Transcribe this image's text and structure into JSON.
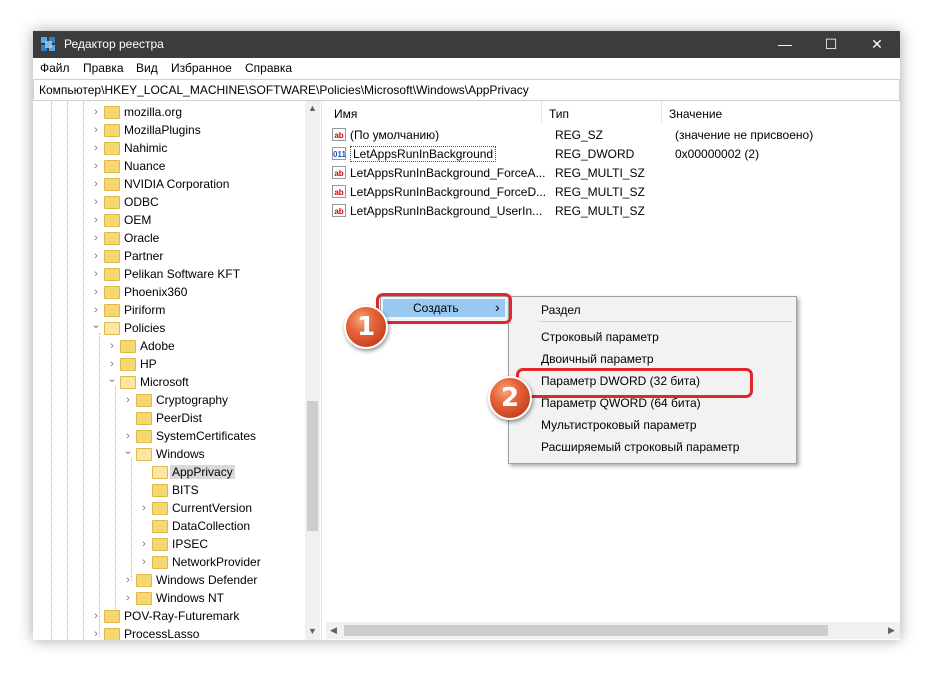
{
  "window": {
    "title": "Редактор реестра",
    "app_icon": "regedit-icon",
    "controls": {
      "minimize": "—",
      "maximize": "☐",
      "close": "✕"
    }
  },
  "menu": [
    "Файл",
    "Правка",
    "Вид",
    "Избранное",
    "Справка"
  ],
  "address": "Компьютер\\HKEY_LOCAL_MACHINE\\SOFTWARE\\Policies\\Microsoft\\Windows\\AppPrivacy",
  "tree": [
    {
      "label": "mozilla.org",
      "level": 0,
      "expander": "collapsed"
    },
    {
      "label": "MozillaPlugins",
      "level": 0,
      "expander": "collapsed"
    },
    {
      "label": "Nahimic",
      "level": 0,
      "expander": "collapsed"
    },
    {
      "label": "Nuance",
      "level": 0,
      "expander": "collapsed"
    },
    {
      "label": "NVIDIA Corporation",
      "level": 0,
      "expander": "collapsed"
    },
    {
      "label": "ODBC",
      "level": 0,
      "expander": "collapsed"
    },
    {
      "label": "OEM",
      "level": 0,
      "expander": "collapsed"
    },
    {
      "label": "Oracle",
      "level": 0,
      "expander": "collapsed"
    },
    {
      "label": "Partner",
      "level": 0,
      "expander": "collapsed"
    },
    {
      "label": "Pelikan Software KFT",
      "level": 0,
      "expander": "collapsed"
    },
    {
      "label": "Phoenix360",
      "level": 0,
      "expander": "collapsed"
    },
    {
      "label": "Piriform",
      "level": 0,
      "expander": "collapsed"
    },
    {
      "label": "Policies",
      "level": 0,
      "expander": "expanded"
    },
    {
      "label": "Adobe",
      "level": 1,
      "expander": "collapsed"
    },
    {
      "label": "HP",
      "level": 1,
      "expander": "collapsed"
    },
    {
      "label": "Microsoft",
      "level": 1,
      "expander": "expanded"
    },
    {
      "label": "Cryptography",
      "level": 2,
      "expander": "collapsed"
    },
    {
      "label": "PeerDist",
      "level": 2,
      "expander": "none"
    },
    {
      "label": "SystemCertificates",
      "level": 2,
      "expander": "collapsed"
    },
    {
      "label": "Windows",
      "level": 2,
      "expander": "expanded"
    },
    {
      "label": "AppPrivacy",
      "level": 3,
      "expander": "none",
      "selected": true
    },
    {
      "label": "BITS",
      "level": 3,
      "expander": "none"
    },
    {
      "label": "CurrentVersion",
      "level": 3,
      "expander": "collapsed"
    },
    {
      "label": "DataCollection",
      "level": 3,
      "expander": "none"
    },
    {
      "label": "IPSEC",
      "level": 3,
      "expander": "collapsed"
    },
    {
      "label": "NetworkProvider",
      "level": 3,
      "expander": "collapsed"
    },
    {
      "label": "Windows Defender",
      "level": 2,
      "expander": "collapsed"
    },
    {
      "label": "Windows NT",
      "level": 2,
      "expander": "collapsed"
    },
    {
      "label": "POV-Ray-Futuremark",
      "level": 0,
      "expander": "collapsed"
    },
    {
      "label": "ProcessLasso",
      "level": 0,
      "expander": "collapsed"
    }
  ],
  "list": {
    "columns": [
      "Имя",
      "Тип",
      "Значение"
    ],
    "rows": [
      {
        "icon": "string-value-icon",
        "icon_text": "ab",
        "name": "(По умолчанию)",
        "type": "REG_SZ",
        "value": "(значение не присвоено)"
      },
      {
        "icon": "binary-value-icon",
        "icon_text": "011",
        "name": "LetAppsRunInBackground",
        "type": "REG_DWORD",
        "value": "0x00000002 (2)",
        "focused": true
      },
      {
        "icon": "string-value-icon",
        "icon_text": "ab",
        "name": "LetAppsRunInBackground_ForceA...",
        "type": "REG_MULTI_SZ",
        "value": ""
      },
      {
        "icon": "string-value-icon",
        "icon_text": "ab",
        "name": "LetAppsRunInBackground_ForceD...",
        "type": "REG_MULTI_SZ",
        "value": ""
      },
      {
        "icon": "string-value-icon",
        "icon_text": "ab",
        "name": "LetAppsRunInBackground_UserIn...",
        "type": "REG_MULTI_SZ",
        "value": ""
      }
    ]
  },
  "context_menu": {
    "item": "Создать",
    "arrow": "›"
  },
  "submenu": {
    "items": [
      "Раздел",
      "Строковый параметр",
      "Двоичный параметр",
      "Параметр DWORD (32 бита)",
      "Параметр QWORD (64 бита)",
      "Мультистроковый параметр",
      "Расширяемый строковый параметр"
    ]
  },
  "annotations": {
    "step1": "1",
    "step2": "2"
  },
  "colors": {
    "highlight": "#e1272b",
    "badge": "#e8643a",
    "titlebar": "#3c3c3c",
    "menu_hover": "#99c9f0"
  }
}
